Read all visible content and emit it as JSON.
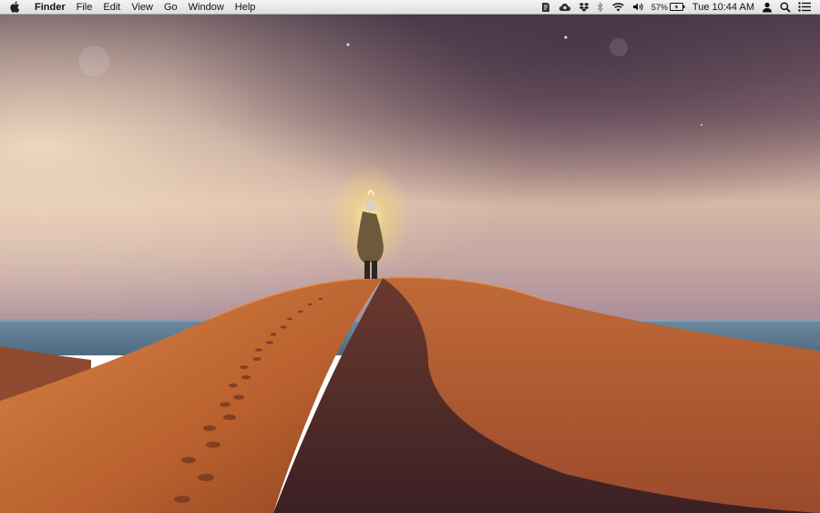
{
  "menubar": {
    "app_name": "Finder",
    "menus": [
      "File",
      "Edit",
      "View",
      "Go",
      "Window",
      "Help"
    ],
    "status_icons": [
      "evernote-icon",
      "cloud-app-icon",
      "dropbox-icon",
      "bluetooth-icon",
      "wifi-icon",
      "volume-icon"
    ],
    "battery_percent": "57%",
    "clock": "Tue 10:44 AM"
  },
  "wallpaper": {
    "description": "desert-dune-sea",
    "colors": {
      "sky_top": "#4e3a4b",
      "sky_horizon": "#e9cdb2",
      "sea": "#5f7a92",
      "dune_light": "#c8743c",
      "dune_shadow": "#4a2a28"
    }
  }
}
